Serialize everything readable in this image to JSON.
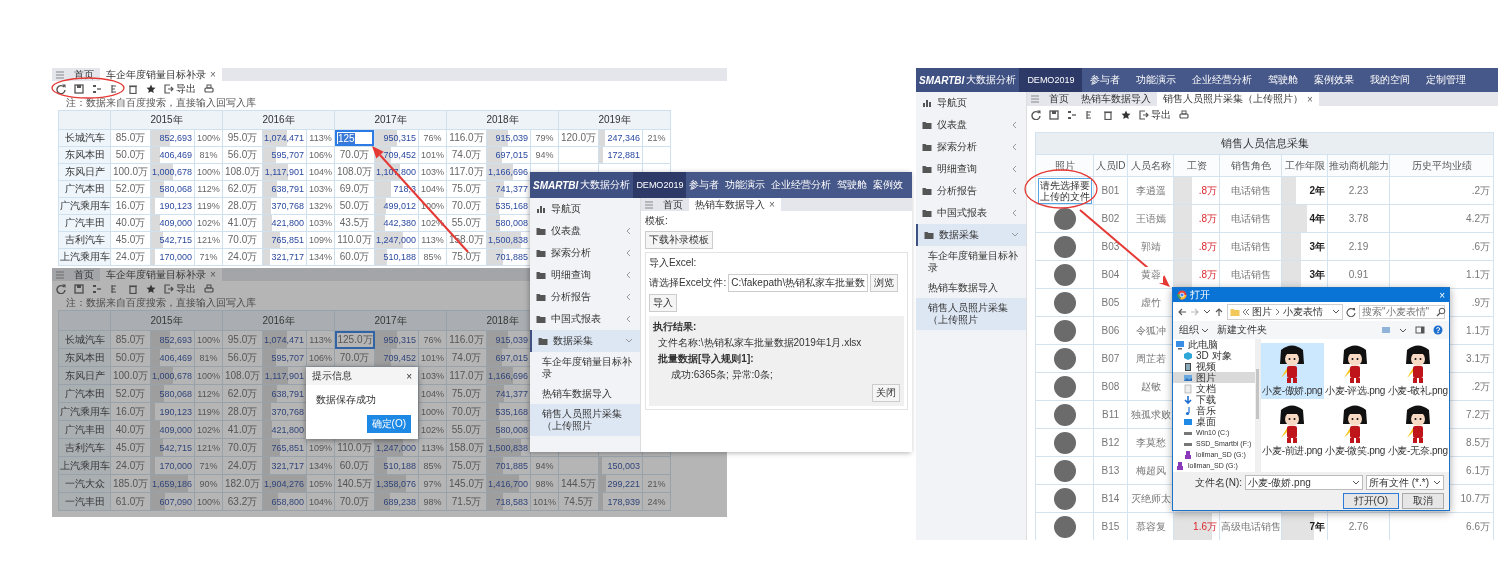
{
  "report": {
    "tabs": [
      {
        "label": "首页",
        "selected": false
      },
      {
        "label": "车企年度销量目标补录",
        "selected": true,
        "close": "×"
      }
    ],
    "export_label": "导出",
    "note": "注：数据来自百度搜索，直接输入回写入库",
    "years": [
      "2015年",
      "2016年",
      "2017年",
      "2018年",
      "2019年"
    ],
    "rows": [
      {
        "brand": "长城汽车",
        "years": [
          {
            "target": "85.0万",
            "actual": "852,693",
            "pct": "100%",
            "level": 0.45
          },
          {
            "target": "95.0万",
            "actual": "1,074,471",
            "pct": "113%",
            "level": 0.56
          },
          {
            "target": "125",
            "editing": true,
            "actual": "950,315",
            "pct": "76%",
            "level": 0.5
          },
          {
            "target": "116.0万",
            "actual": "915,039",
            "pct": "79%",
            "level": 0.48
          },
          {
            "target": "120.0万",
            "actual": "247,346",
            "pct": "21%",
            "level": 0.13
          }
        ]
      },
      {
        "brand": "东风本田",
        "years": [
          {
            "target": "50.0万",
            "actual": "406,469",
            "pct": "81%",
            "level": 0.21
          },
          {
            "target": "56.0万",
            "actual": "595,707",
            "pct": "106%",
            "level": 0.31
          },
          {
            "target": "70.0万",
            "actual": "709,452",
            "pct": "101%",
            "level": 0.37
          },
          {
            "target": "74.0万",
            "actual": "697,015",
            "pct": "94%",
            "level": 0.36
          },
          {
            "actual": "172,881",
            "level": 0.09
          }
        ]
      },
      {
        "brand": "东风日产",
        "years": [
          {
            "target": "100.0万",
            "actual": "1,000,678",
            "pct": "100%",
            "level": 0.52
          },
          {
            "target": "108.0万",
            "actual": "1,117,901",
            "pct": "104%",
            "level": 0.58
          },
          {
            "target": "108.0万",
            "actual": "1,107,800",
            "pct": "103%",
            "level": 0.58
          },
          {
            "target": "117.0万",
            "actual": "1,166,696",
            "level": 0.61
          }
        ]
      },
      {
        "brand": "广汽本田",
        "years": [
          {
            "target": "52.0万",
            "actual": "580,068",
            "pct": "112%",
            "level": 0.3
          },
          {
            "target": "62.0万",
            "actual": "638,791",
            "pct": "103%",
            "level": 0.33
          },
          {
            "target": "69.0万",
            "actual": "718,3",
            "pct": "104%",
            "level": 0.37
          },
          {
            "target": "75.0万",
            "actual": "741,377",
            "level": 0.39
          }
        ]
      },
      {
        "brand": "广汽乘用车",
        "years": [
          {
            "target": "16.0万",
            "actual": "190,123",
            "pct": "119%",
            "level": 0.1
          },
          {
            "target": "28.0万",
            "actual": "370,768",
            "pct": "132%",
            "level": 0.19
          },
          {
            "target": "50.0万",
            "actual": "499,012",
            "pct": "100%",
            "level": 0.26
          },
          {
            "target": "70.0万",
            "actual": "535,168",
            "level": 0.28
          }
        ]
      },
      {
        "brand": "广汽丰田",
        "years": [
          {
            "target": "40.0万",
            "actual": "409,000",
            "pct": "102%",
            "level": 0.21
          },
          {
            "target": "41.0万",
            "actual": "421,800",
            "pct": "103%",
            "level": 0.22
          },
          {
            "target": "43.5万",
            "actual": "442,380",
            "pct": "102%",
            "level": 0.23
          },
          {
            "target": "55.0万",
            "actual": "580,008",
            "level": 0.3
          }
        ]
      },
      {
        "brand": "吉利汽车",
        "years": [
          {
            "target": "45.0万",
            "actual": "542,715",
            "pct": "121%",
            "level": 0.28
          },
          {
            "target": "70.0万",
            "actual": "765,851",
            "pct": "109%",
            "level": 0.4
          },
          {
            "target": "110.0万",
            "actual": "1,247,000",
            "pct": "113%",
            "level": 0.66
          },
          {
            "target": "158.0万",
            "actual": "1,500,838",
            "level": 0.79
          }
        ]
      },
      {
        "brand": "上汽乘用车",
        "years": [
          {
            "target": "24.0万",
            "actual": "170,000",
            "pct": "71%",
            "level": 0.09
          },
          {
            "target": "24.0万",
            "actual": "321,717",
            "pct": "134%",
            "level": 0.17
          },
          {
            "target": "60.0万",
            "actual": "510,188",
            "pct": "85%",
            "level": 0.27
          },
          {
            "target": "75.0万",
            "actual": "701,885",
            "level": 0.37
          }
        ]
      }
    ]
  },
  "report_dimmed": {
    "tabs": [
      {
        "label": "首页",
        "selected": false
      },
      {
        "label": "车企年度销量目标补录",
        "selected": true,
        "close": "×"
      }
    ],
    "export_label": "导出",
    "note": "注：数据来自百度搜索，直接输入回写入库",
    "years": [
      "2015年",
      "2016年",
      "2017年",
      "2018年"
    ],
    "rows": [
      {
        "brand": "长城汽车",
        "years": [
          {
            "target": "85.0万",
            "actual": "852,693",
            "pct": "100%",
            "level": 0.45
          },
          {
            "target": "95.0万",
            "actual": "1,074,471",
            "pct": "113%",
            "level": 0.56
          },
          {
            "target": "125.0万",
            "selected": true,
            "actual": "950,315",
            "pct": "76%",
            "level": 0.5
          },
          {
            "target": "116.0万",
            "actual": "915,039",
            "level": 0.48
          }
        ]
      },
      {
        "brand": "东风本田",
        "years": [
          {
            "target": "50.0万",
            "actual": "406,469",
            "pct": "81%",
            "level": 0.21
          },
          {
            "target": "56.0万",
            "actual": "595,707",
            "pct": "106%",
            "level": 0.31
          },
          {
            "target": "70.0万",
            "actual": "709,452",
            "pct": "101%",
            "level": 0.37
          },
          {
            "target": "74.0万",
            "actual": "697,015",
            "level": 0.36
          }
        ]
      },
      {
        "brand": "东风日产",
        "years": [
          {
            "target": "100.0万",
            "actual": "1,000,678",
            "pct": "100%",
            "level": 0.52
          },
          {
            "target": "108.0万",
            "actual": "1,117,901",
            "level": 0.58
          },
          {
            "pct": "103%"
          },
          {
            "target": "117.0万",
            "actual": "1,166,696",
            "level": 0.61
          }
        ]
      },
      {
        "brand": "广汽本田",
        "years": [
          {
            "target": "52.0万",
            "actual": "580,068",
            "pct": "112%",
            "level": 0.3
          },
          {
            "target": "62.0万",
            "actual": "638,791",
            "level": 0.33
          },
          {
            "pct": "104%"
          },
          {
            "target": "75.0万",
            "actual": "741,377",
            "level": 0.39
          }
        ]
      },
      {
        "brand": "广汽乘用车",
        "years": [
          {
            "target": "16.0万",
            "actual": "190,123",
            "pct": "119%",
            "level": 0.1
          },
          {
            "target": "28.0万",
            "actual": "370,768",
            "level": 0.19
          },
          {
            "pct": "100%"
          },
          {
            "target": "70.0万",
            "actual": "535,168",
            "level": 0.28
          }
        ]
      },
      {
        "brand": "广汽丰田",
        "years": [
          {
            "target": "40.0万",
            "actual": "409,000",
            "pct": "102%",
            "level": 0.21
          },
          {
            "target": "41.0万",
            "actual": "421,800",
            "level": 0.22
          },
          {
            "pct": "102%"
          },
          {
            "target": "55.0万",
            "actual": "580,008",
            "level": 0.3
          }
        ]
      },
      {
        "brand": "吉利汽车",
        "years": [
          {
            "target": "45.0万",
            "actual": "542,715",
            "pct": "121%",
            "level": 0.28
          },
          {
            "target": "70.0万",
            "actual": "765,851",
            "pct": "109%",
            "level": 0.4
          },
          {
            "target": "110.0万",
            "actual": "1,247,000",
            "pct": "113%",
            "level": 0.66
          },
          {
            "target": "158.0万",
            "actual": "1,500,838",
            "level": 0.79
          }
        ]
      },
      {
        "brand": "上汽乘用车",
        "years": [
          {
            "target": "24.0万",
            "actual": "170,000",
            "pct": "71%",
            "level": 0.09
          },
          {
            "target": "24.0万",
            "actual": "321,717",
            "pct": "134%",
            "level": 0.17
          },
          {
            "target": "60.0万",
            "actual": "510,188",
            "pct": "85%",
            "level": 0.27
          },
          {
            "target": "75.0万",
            "actual": "701,885",
            "pct": "94%",
            "level": 0.37
          },
          {
            "actual": "150,003",
            "level": 0.08
          }
        ]
      },
      {
        "brand": "一汽大众",
        "years": [
          {
            "target": "185.0万",
            "actual": "1,659,186",
            "pct": "90%",
            "level": 0.87
          },
          {
            "target": "182.0万",
            "actual": "1,904,276",
            "pct": "105%",
            "level": 1
          },
          {
            "target": "140.5万",
            "actual": "1,358,076",
            "pct": "97%",
            "level": 0.71
          },
          {
            "target": "145.0万",
            "actual": "1,416,700",
            "pct": "98%",
            "level": 0.75
          },
          {
            "target": "144.5万",
            "actual": "299,221",
            "pct": "21%",
            "level": 0.16
          }
        ]
      },
      {
        "brand": "一汽丰田",
        "years": [
          {
            "target": "61.0万",
            "actual": "607,090",
            "pct": "100%",
            "level": 0.32
          },
          {
            "target": "63.2万",
            "actual": "658,800",
            "pct": "104%",
            "level": 0.35
          },
          {
            "target": "70.0万",
            "actual": "689,238",
            "pct": "98%",
            "level": 0.36
          },
          {
            "target": "71.5万",
            "actual": "718,583",
            "pct": "101%",
            "level": 0.38
          },
          {
            "target": "74.5万",
            "actual": "178,939",
            "pct": "24%",
            "level": 0.09
          }
        ]
      }
    ],
    "dialog": {
      "title": "提示信息",
      "close": "×",
      "message": "数据保存成功",
      "button": "确定(O)"
    }
  },
  "import_app": {
    "logo": "SMARTBI",
    "logo_sub": "大数据分析",
    "nav": [
      {
        "label": "DEMO2019",
        "selected": true
      },
      {
        "label": "参与者",
        "selected": false
      },
      {
        "label": "功能演示",
        "selected": false
      },
      {
        "label": "企业经营分析",
        "selected": false
      },
      {
        "label": "驾驶舱",
        "selected": false
      },
      {
        "label": "案例效",
        "selected": false
      }
    ],
    "sidebar": [
      {
        "label": "导航页",
        "kind": "home"
      },
      {
        "label": "仪表盘",
        "kind": "folder",
        "expanded": false
      },
      {
        "label": "探索分析",
        "kind": "folder",
        "expanded": false
      },
      {
        "label": "明细查询",
        "kind": "folder",
        "expanded": false
      },
      {
        "label": "分析报告",
        "kind": "folder",
        "expanded": false
      },
      {
        "label": "中国式报表",
        "kind": "folder",
        "expanded": false
      },
      {
        "label": "数据采集",
        "kind": "folder",
        "expanded": true,
        "children": [
          {
            "label": "车企年度销量目标补录",
            "selected": false
          },
          {
            "label": "热销车数据导入",
            "selected": false
          },
          {
            "label": "销售人员照片采集（上传照片",
            "selected": true
          }
        ]
      }
    ],
    "tabs": [
      {
        "label": "首页",
        "selected": false
      },
      {
        "label": "热销车数据导入",
        "selected": true,
        "close": "×"
      }
    ],
    "template_label": "模板:",
    "template_button": "下载补录模板",
    "excel_legend": "导入Excel:",
    "file_label": "请选择Excel文件:",
    "file_value": "C:\\fakepath\\热销私家车批量数",
    "browse_button": "浏览",
    "import_button": "导入",
    "result": {
      "title": "执行结果:",
      "file_line": "文件名称:\\热销私家车批量数据2019年1月.xlsx",
      "rule_line": "批量数据[导入规则1]:",
      "count_line": "成功:6365条; 异常:0条;"
    },
    "close_button": "关闭"
  },
  "photo_app": {
    "logo": "SMARTBI",
    "logo_sub": "大数据分析",
    "nav": [
      {
        "label": "DEMO2019",
        "selected": true
      },
      {
        "label": "参与者",
        "selected": false
      },
      {
        "label": "功能演示",
        "selected": false
      },
      {
        "label": "企业经营分析",
        "selected": false
      },
      {
        "label": "驾驶舱",
        "selected": false
      },
      {
        "label": "案例效果",
        "selected": false
      },
      {
        "label": "我的空间",
        "selected": false
      },
      {
        "label": "定制管理",
        "selected": false
      }
    ],
    "sidebar": [
      {
        "label": "导航页",
        "kind": "home"
      },
      {
        "label": "仪表盘",
        "kind": "folder",
        "expanded": false
      },
      {
        "label": "探索分析",
        "kind": "folder",
        "expanded": false
      },
      {
        "label": "明细查询",
        "kind": "folder",
        "expanded": false
      },
      {
        "label": "分析报告",
        "kind": "folder",
        "expanded": false
      },
      {
        "label": "中国式报表",
        "kind": "folder",
        "expanded": false
      },
      {
        "label": "数据采集",
        "kind": "folder",
        "expanded": true,
        "children": [
          {
            "label": "车企年度销量目标补录",
            "selected": false
          },
          {
            "label": "热销车数据导入",
            "selected": false
          },
          {
            "label": "销售人员照片采集（上传照片",
            "selected": true
          }
        ]
      }
    ],
    "tabs": [
      {
        "label": "首页",
        "selected": false
      },
      {
        "label": "热销车数据导入",
        "selected": false
      },
      {
        "label": "销售人员照片采集（上传照片）",
        "selected": true,
        "close": "×"
      }
    ],
    "export_label": "导出",
    "table": {
      "title": "销售人员信息采集",
      "columns": [
        "照片",
        "人员ID",
        "人员名称",
        "工资",
        "销售角色",
        "工作年限",
        "推动商机能力",
        "历史平均业绩"
      ],
      "rows": [
        {
          "kind": "upload",
          "upload_text": "请先选择要上传的文件",
          "id": "B01",
          "name": "李逍遥",
          "salary": {
            "text": ".8万",
            "level": 0.4
          },
          "role": "电话销售",
          "years": {
            "text": "2年",
            "level": 0.3
          },
          "ability": "2.23",
          "avg": ".2万"
        },
        {
          "kind": "avatar",
          "id": "B02",
          "name": "王语嫣",
          "salary": {
            "text": ".8万",
            "level": 0.4
          },
          "role": "电话销售",
          "years": {
            "text": "4年",
            "level": 0.55
          },
          "ability": "3.78",
          "avg": "4.2万"
        },
        {
          "kind": "avatar",
          "id": "B03",
          "name": "郭靖",
          "salary": {
            "text": ".8万",
            "level": 0.4
          },
          "role": "电话销售",
          "years": {
            "text": "3年",
            "level": 0.42
          },
          "ability": "2.19",
          "avg": ".6万"
        },
        {
          "kind": "avatar",
          "id": "B04",
          "name": "黄蓉",
          "salary": {
            "text": ".8万",
            "level": 0.4
          },
          "role": "电话销售",
          "years": {
            "text": "3年",
            "level": 0.42
          },
          "ability": "0.91",
          "avg": "1.1万"
        },
        {
          "kind": "avatar",
          "id": "B05",
          "name": "虚竹",
          "avg": ".9万"
        },
        {
          "kind": "avatar",
          "id": "B06",
          "name": "令狐冲",
          "avg": "1.1万"
        },
        {
          "kind": "avatar",
          "id": "B07",
          "name": "周芷若",
          "avg": "3.1万"
        },
        {
          "kind": "avatar",
          "id": "B08",
          "name": "赵敏",
          "avg": ".2万"
        },
        {
          "kind": "avatar",
          "id": "B11",
          "name": "独孤求败",
          "avg": "7.2万"
        },
        {
          "kind": "avatar",
          "id": "B12",
          "name": "李莫愁",
          "avg": "8.5万"
        },
        {
          "kind": "avatar",
          "id": "B13",
          "name": "梅超风",
          "avg": "6.1万"
        },
        {
          "kind": "avatar",
          "id": "B14",
          "name": "灭绝师太",
          "avg": "10.7万"
        },
        {
          "kind": "avatar",
          "id": "B15",
          "name": "慕容复",
          "salary": {
            "text": "1.6万",
            "level": 0.85
          },
          "role": "高级电话销售",
          "years": {
            "text": "7年",
            "level": 0.7
          },
          "ability": "2.76",
          "avg": "6.6万"
        }
      ]
    }
  },
  "file_dialog": {
    "title": "打开",
    "close": "×",
    "path": [
      "图片",
      "小麦表情"
    ],
    "search_placeholder": "搜索\"小麦表情\"",
    "organize": "组织",
    "new_folder": "新建文件夹",
    "tree": [
      {
        "label": "此电脑",
        "kind": "pc",
        "selected": false,
        "children": [
          {
            "label": "3D 对象",
            "kind": "cube",
            "selected": false
          },
          {
            "label": "视频",
            "kind": "video",
            "selected": false
          },
          {
            "label": "图片",
            "kind": "pictures",
            "selected": true
          },
          {
            "label": "文档",
            "kind": "docs",
            "selected": false
          },
          {
            "label": "下载",
            "kind": "download",
            "selected": false
          },
          {
            "label": "音乐",
            "kind": "music",
            "selected": false
          },
          {
            "label": "桌面",
            "kind": "desktop",
            "selected": false
          },
          {
            "label": "Win10 (C:)",
            "kind": "drive",
            "selected": false
          },
          {
            "label": "SSD_Smartbi (F:)",
            "kind": "drive",
            "selected": false
          },
          {
            "label": "lollman_SD (G:)",
            "kind": "usb",
            "selected": false
          }
        ]
      },
      {
        "label": "lollman_SD (G:)",
        "kind": "usb",
        "selected": false
      }
    ],
    "files": [
      {
        "name": "小麦-傲娇.png",
        "selected": true
      },
      {
        "name": "小麦-评选.png",
        "selected": false
      },
      {
        "name": "小麦-敬礼.png",
        "selected": false
      },
      {
        "name": "小麦-前进.png",
        "selected": false
      },
      {
        "name": "小麦-微笑.png",
        "selected": false
      },
      {
        "name": "小麦-无奈.png",
        "selected": false
      }
    ],
    "filename_label": "文件名(N):",
    "filename": "小麦-傲娇.png",
    "filter": "所有文件 (*.*)",
    "open_button": "打开(O)",
    "cancel_button": "取消"
  }
}
